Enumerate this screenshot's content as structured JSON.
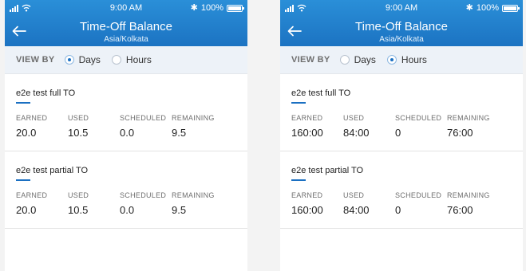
{
  "screens": [
    {
      "status_bar": {
        "time": "9:00 AM",
        "battery": "100%"
      },
      "header": {
        "title": "Time-Off Balance",
        "timezone": "Asia/Kolkata"
      },
      "view_by": {
        "label": "VIEW BY",
        "options": [
          "Days",
          "Hours"
        ],
        "selected": "Days"
      },
      "balances": [
        {
          "name": "e2e test full TO",
          "labels": {
            "earned": "EARNED",
            "used": "USED",
            "scheduled": "SCHEDULED",
            "remaining": "REMAINING"
          },
          "values": {
            "earned": "20.0",
            "used": "10.5",
            "scheduled": "0.0",
            "remaining": "9.5"
          }
        },
        {
          "name": "e2e test partial TO",
          "labels": {
            "earned": "EARNED",
            "used": "USED",
            "scheduled": "SCHEDULED",
            "remaining": "REMAINING"
          },
          "values": {
            "earned": "20.0",
            "used": "10.5",
            "scheduled": "0.0",
            "remaining": "9.5"
          }
        }
      ]
    },
    {
      "status_bar": {
        "time": "9:00 AM",
        "battery": "100%"
      },
      "header": {
        "title": "Time-Off Balance",
        "timezone": "Asia/Kolkata"
      },
      "view_by": {
        "label": "VIEW BY",
        "options": [
          "Days",
          "Hours"
        ],
        "selected": "Hours"
      },
      "balances": [
        {
          "name": "e2e test full TO",
          "labels": {
            "earned": "EARNED",
            "used": "USED",
            "scheduled": "SCHEDULED",
            "remaining": "REMAINING"
          },
          "values": {
            "earned": "160:00",
            "used": "84:00",
            "scheduled": "0",
            "remaining": "76:00"
          }
        },
        {
          "name": "e2e test partial TO",
          "labels": {
            "earned": "EARNED",
            "used": "USED",
            "scheduled": "SCHEDULED",
            "remaining": "REMAINING"
          },
          "values": {
            "earned": "160:00",
            "used": "84:00",
            "scheduled": "0",
            "remaining": "76:00"
          }
        }
      ]
    }
  ],
  "colors": {
    "header_top": "#2a8fd8",
    "header_bottom": "#1c73c2",
    "accent": "#1b70c2",
    "view_by_bg": "#edf2f8"
  },
  "icons": {
    "signal": "cellular-signal-icon",
    "wifi": "wifi-icon",
    "bluetooth": "bluetooth-icon",
    "battery": "battery-icon",
    "back": "back-arrow-icon"
  }
}
